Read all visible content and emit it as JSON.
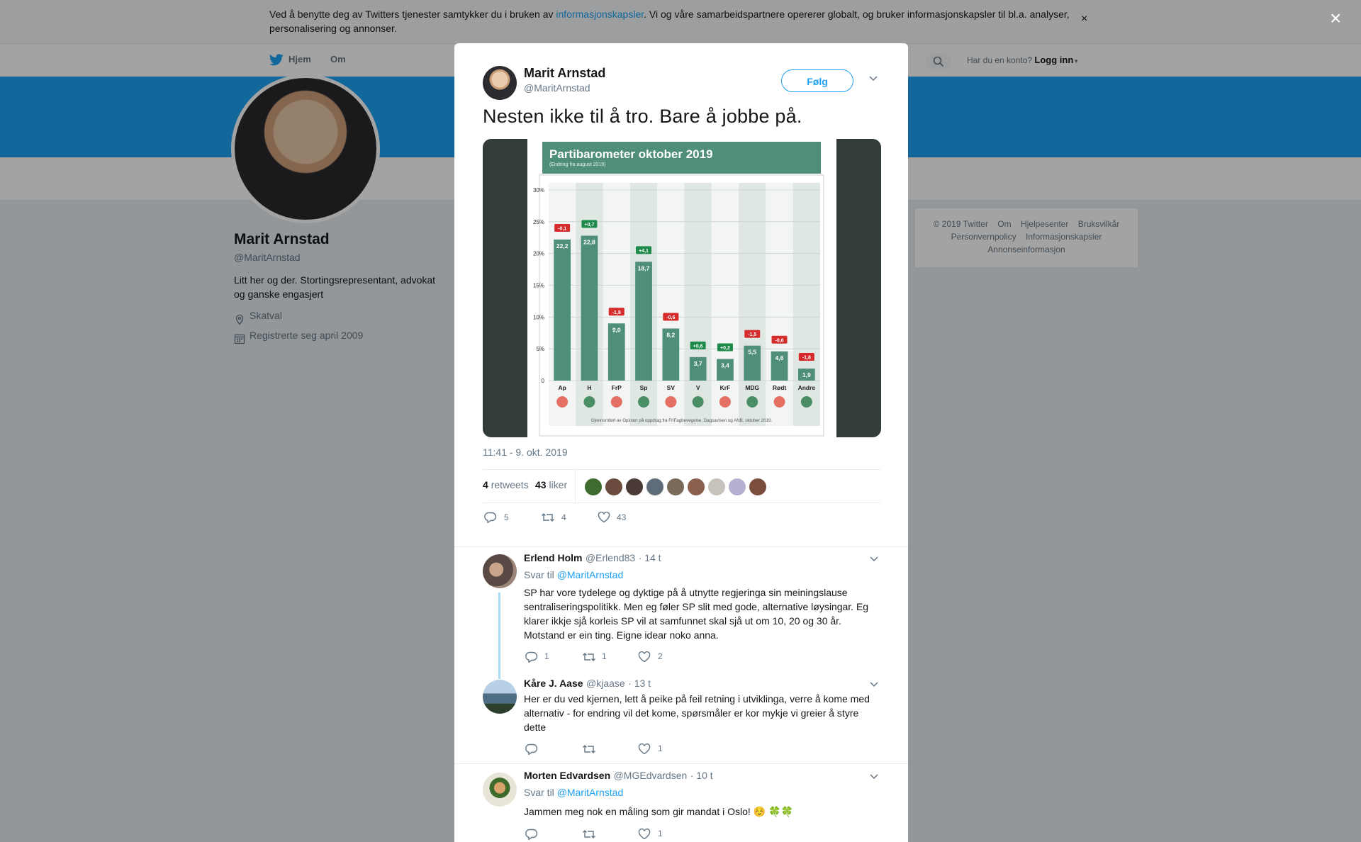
{
  "cookie_banner": {
    "text_before": "Ved å benytte deg av Twitters tjenester samtykker du i bruken av ",
    "link": "informasjonskapsler",
    "text_after": ". Vi og våre samarbeidspartnere opererer globalt, og bruker informasjonskapsler til bl.a. analyser, personalisering og annonser.",
    "close_icon": "×"
  },
  "overlay_close_icon": "×",
  "topnav": {
    "home": "Hjem",
    "about": "Om",
    "account_prompt": "Har du en konto?",
    "login": "Logg inn"
  },
  "profile": {
    "name": "Marit Arnstad",
    "handle": "@MaritArnstad",
    "bio": "Litt her og der. Stortingsrepresentant, advokat og ganske engasjert",
    "location": "Skatval",
    "joined": "Registrerte seg april 2009"
  },
  "footer": {
    "line1": [
      "© 2019 Twitter",
      "Om",
      "Hjelpesenter",
      "Bruksvilkår"
    ],
    "line2": [
      "Personvernpolicy",
      "Informasjonskapsler"
    ],
    "line3": [
      "Annonseinformasjon"
    ]
  },
  "tweet": {
    "author_name": "Marit Arnstad",
    "author_handle": "@MaritArnstad",
    "follow_label": "Følg",
    "text": "Nesten ikke til å tro. Bare å jobbe på.",
    "timestamp": "11:41 - 9. okt. 2019",
    "retweets_count": "4",
    "retweets_label": "retweets",
    "likes_count": "43",
    "likes_label": "liker",
    "actions": {
      "replies": "5",
      "retweets": "4",
      "likes": "43"
    }
  },
  "replies": [
    {
      "name": "Erlend Holm",
      "handle": "@Erlend83",
      "time": "· 14 t",
      "reply_to_prefix": "Svar til",
      "reply_to": "@MaritArnstad",
      "text": "SP har vore tydelege og dyktige på å utnytte regjeringa sin meiningslause sentraliseringspolitikk. Men eg føler SP slit med gode, alternative løysingar. Eg klarer ikkje sjå korleis SP vil at samfunnet skal sjå ut om 10, 20 og 30 år. Motstand er ein ting. Eigne idear noko anna.",
      "replies": "1",
      "retweets": "1",
      "likes": "2"
    },
    {
      "name": "Kåre J. Aase",
      "handle": "@kjaase",
      "time": "· 13 t",
      "text": "Her er du ved kjernen, lett å peike på feil retning i utviklinga, verre å kome med alternativ - for endring vil det kome, spørsmåler er kor mykje vi greier å styre dette",
      "replies": "",
      "retweets": "",
      "likes": "1"
    },
    {
      "name": "Morten Edvardsen",
      "handle": "@MGEdvardsen",
      "time": "· 10 t",
      "reply_to_prefix": "Svar til",
      "reply_to": "@MaritArnstad",
      "text": "Jammen meg nok en måling som gir mandat i Oslo! ☺️ 🍀🍀",
      "replies": "",
      "retweets": "",
      "likes": "1"
    }
  ],
  "colors": {
    "accent": "#1da1f2",
    "chart_green": "#4f8f79",
    "change_red": "#d52b2b",
    "change_green": "#1d8a4a"
  },
  "chart_data": {
    "type": "bar",
    "title": "Partibarometer oktober 2019",
    "subtitle": "(Endring fra august 2019)",
    "categories": [
      "Ap",
      "H",
      "FrP",
      "Sp",
      "SV",
      "V",
      "KrF",
      "MDG",
      "Rødt",
      "Andre"
    ],
    "values": [
      22.2,
      22.8,
      9.0,
      18.7,
      8.2,
      3.7,
      3.4,
      5.5,
      4.6,
      1.9
    ],
    "value_labels": [
      "22,2",
      "22,8",
      "9,0",
      "18,7",
      "8,2",
      "3,7",
      "3,4",
      "5,5",
      "4,6",
      "1,9"
    ],
    "changes": [
      "-0,1",
      "+0,7",
      "-1,9",
      "+4,1",
      "-0,6",
      "+0,6",
      "+0,2",
      "-1,5",
      "-0,6",
      "-1,8"
    ],
    "yticks": [
      "30%",
      "25%",
      "20%",
      "15%",
      "10%",
      "5%",
      "0"
    ],
    "ylim": [
      0,
      30
    ],
    "source": "Gjennomført av Opinion på oppdrag fra FriFagbevegelse, Dagsavisen og ANB, oktober 2019."
  }
}
